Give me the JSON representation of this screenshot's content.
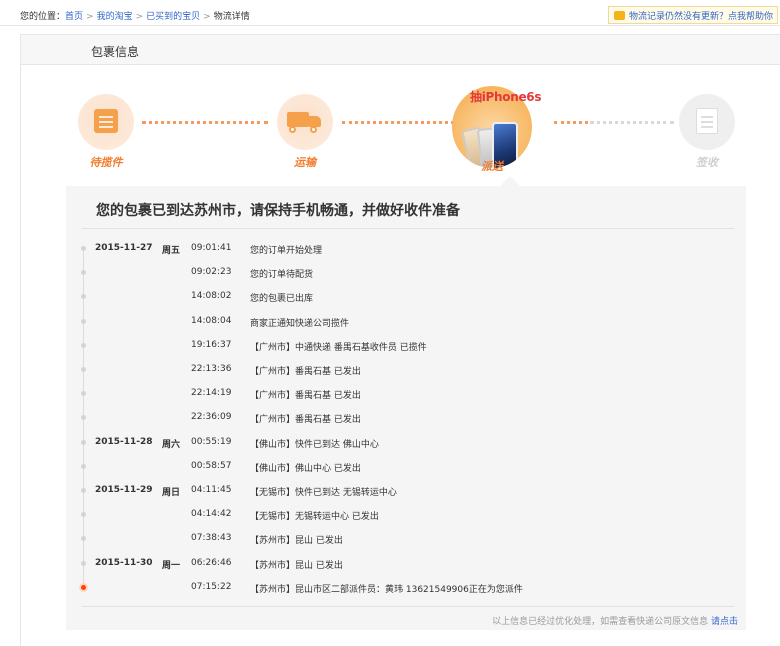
{
  "breadcrumb": {
    "prefix": "您的位置：",
    "items": [
      "首页",
      "我的淘宝",
      "已买到的宝贝"
    ],
    "current": "物流详情",
    "separator": ">"
  },
  "notice": {
    "text": "物流记录仍然没有更新？点我帮助你",
    "icon": "chat-bubble-icon"
  },
  "card": {
    "title": "包裹信息"
  },
  "steps": [
    {
      "label": "待揽件",
      "state": "done",
      "icon": "package-box-icon"
    },
    {
      "label": "运输",
      "state": "done",
      "icon": "truck-icon"
    },
    {
      "label": "派送",
      "state": "current",
      "icon": "iphone-promo"
    },
    {
      "label": "签收",
      "state": "pending",
      "icon": "signed-document-icon"
    }
  ],
  "promo": {
    "text": "抽iPhone6s"
  },
  "status": {
    "headline": "您的包裹已到达苏州市，请保持手机畅通，并做好收件准备"
  },
  "timeline": [
    {
      "date": "2015-11-27",
      "weekday": "周五",
      "time": "09:01:41",
      "message": "您的订单开始处理"
    },
    {
      "date": "",
      "weekday": "",
      "time": "09:02:23",
      "message": "您的订单待配货"
    },
    {
      "date": "",
      "weekday": "",
      "time": "14:08:02",
      "message": "您的包裹已出库"
    },
    {
      "date": "",
      "weekday": "",
      "time": "14:08:04",
      "message": "商家正通知快递公司揽件"
    },
    {
      "date": "",
      "weekday": "",
      "time": "19:16:37",
      "message": "【广州市】中通快递 番禺石基收件员 已揽件"
    },
    {
      "date": "",
      "weekday": "",
      "time": "22:13:36",
      "message": "【广州市】番禺石基 已发出"
    },
    {
      "date": "",
      "weekday": "",
      "time": "22:14:19",
      "message": "【广州市】番禺石基 已发出"
    },
    {
      "date": "",
      "weekday": "",
      "time": "22:36:09",
      "message": "【广州市】番禺石基 已发出"
    },
    {
      "date": "2015-11-28",
      "weekday": "周六",
      "time": "00:55:19",
      "message": "【佛山市】快件已到达 佛山中心"
    },
    {
      "date": "",
      "weekday": "",
      "time": "00:58:57",
      "message": "【佛山市】佛山中心 已发出"
    },
    {
      "date": "2015-11-29",
      "weekday": "周日",
      "time": "04:11:45",
      "message": "【无锡市】快件已到达 无锡转运中心"
    },
    {
      "date": "",
      "weekday": "",
      "time": "04:14:42",
      "message": "【无锡市】无锡转运中心 已发出"
    },
    {
      "date": "",
      "weekday": "",
      "time": "07:38:43",
      "message": "【苏州市】昆山 已发出"
    },
    {
      "date": "2015-11-30",
      "weekday": "周一",
      "time": "06:26:46",
      "message": "【苏州市】昆山 已发出"
    },
    {
      "date": "",
      "weekday": "",
      "time": "07:15:22",
      "message": "【苏州市】昆山市区二部派件员：黄玮 13621549906正在为您派件"
    }
  ],
  "footer": {
    "note": "以上信息已经过优化处理，如需查看快递公司原文信息",
    "link": "请点击"
  },
  "colors": {
    "accent": "#f37d2d",
    "link": "#3366cc",
    "latest": "#ff4400"
  }
}
